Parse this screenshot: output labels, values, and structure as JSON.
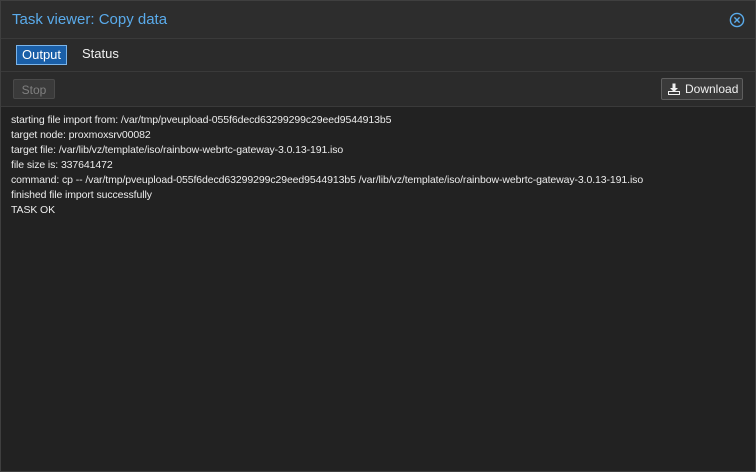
{
  "window": {
    "title": "Task viewer: Copy data"
  },
  "tabs": [
    {
      "label": "Output",
      "active": true
    },
    {
      "label": "Status",
      "active": false
    }
  ],
  "toolbar": {
    "stop_label": "Stop",
    "download_label": "Download"
  },
  "log": {
    "lines": [
      "starting file import from: /var/tmp/pveupload-055f6decd63299299c29eed9544913b5",
      "target node: proxmoxsrv00082",
      "target file: /var/lib/vz/template/iso/rainbow-webrtc-gateway-3.0.13-191.iso",
      "file size is: 337641472",
      "command: cp -- /var/tmp/pveupload-055f6decd63299299c29eed9544913b5 /var/lib/vz/template/iso/rainbow-webrtc-gateway-3.0.13-191.iso",
      "finished file import successfully",
      "TASK OK"
    ]
  },
  "colors": {
    "title": "#5aabeb",
    "active_tab": "#1a5fa8",
    "background": "#222222"
  },
  "icons": {
    "close": "close-circle-icon",
    "download": "download-icon"
  }
}
